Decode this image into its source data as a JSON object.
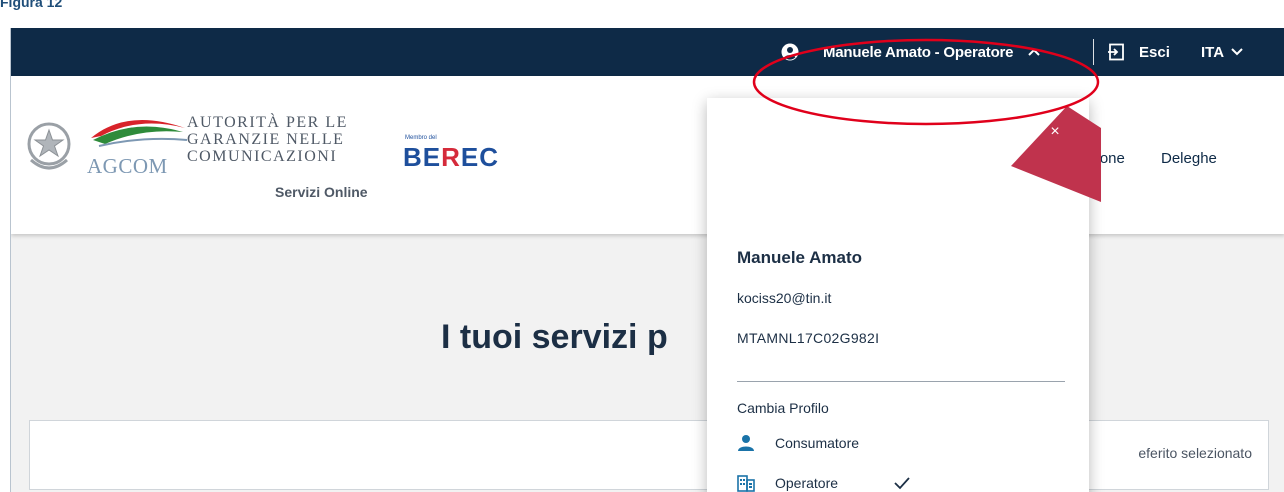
{
  "figure_caption": "Figura 12",
  "topbar": {
    "user_label": "Manuele Amato - Operatore",
    "logout_label": "Esci",
    "language": "ITA"
  },
  "header": {
    "agcom_title_lines": [
      "AUTORITÀ PER LE",
      "GARANZIE NELLE",
      "COMUNICAZIONI"
    ],
    "agcom_word": "AGCOM",
    "servizi_online": "Servizi Online",
    "berec_member": "Membro del",
    "berec_logo_pre": "BE",
    "berec_logo_r": "R",
    "berec_logo_post": "EC",
    "nav_partial": "zione",
    "nav_deleghe": "Deleghe"
  },
  "main": {
    "title": "I tuoi servizi p",
    "card_text": "eferito selezionato"
  },
  "dropdown": {
    "name": "Manuele Amato",
    "email": "kociss20@tin.it",
    "fiscal_code": "MTAMNL17C02G982I",
    "change_profile_label": "Cambia Profilo",
    "options": [
      {
        "label": "Consumatore",
        "icon": "person-icon",
        "selected": false
      },
      {
        "label": "Operatore",
        "icon": "building-icon",
        "selected": true
      }
    ],
    "close_glyph": "×"
  },
  "colors": {
    "topbar_bg": "#0e2a47",
    "accent_red": "#c0334d",
    "annotation_red": "#e0001b",
    "icon_blue": "#1a73a8"
  }
}
